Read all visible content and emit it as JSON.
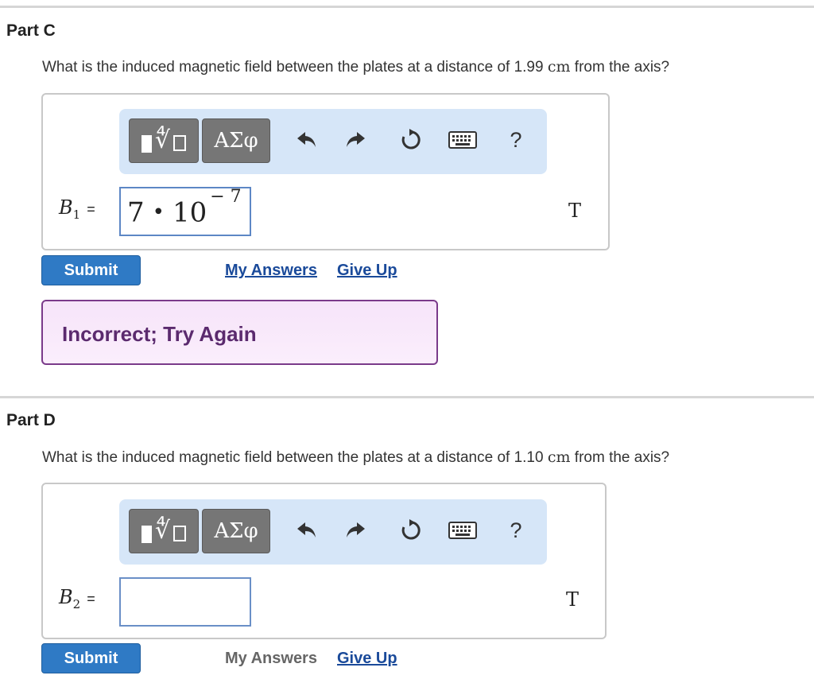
{
  "part_c": {
    "title": "Part C",
    "question_before": "What is the induced magnetic field between the plates at a distance of 1.99 ",
    "question_unit": "cm",
    "question_after": " from the axis?",
    "toolbar": {
      "greek_label": "ΑΣφ",
      "help_label": "?"
    },
    "variable": {
      "symbol": "B",
      "subscript": "1",
      "equals": "="
    },
    "answer": {
      "mantissa": "7",
      "operator": "•",
      "base": "10",
      "exponent": "− 7"
    },
    "unit": "T",
    "submit_label": "Submit",
    "my_answers_label": "My Answers",
    "give_up_label": "Give Up",
    "feedback": "Incorrect; Try Again"
  },
  "part_d": {
    "title": "Part D",
    "question_before": "What is the induced magnetic field between the plates at a distance of 1.10 ",
    "question_unit": "cm",
    "question_after": " from the axis?",
    "toolbar": {
      "greek_label": "ΑΣφ",
      "help_label": "?"
    },
    "variable": {
      "symbol": "B",
      "subscript": "2",
      "equals": "="
    },
    "answer": {
      "value": ""
    },
    "unit": "T",
    "submit_label": "Submit",
    "my_answers_label": "My Answers",
    "give_up_label": "Give Up"
  },
  "colors": {
    "submit_bg": "#2f7ac5",
    "toolbar_bg": "#d6e6f8",
    "feedback_border": "#7a3a8a",
    "feedback_text": "#5b2a6e",
    "link": "#1a4a9a"
  },
  "icons": [
    "template-icon",
    "greek-icon",
    "undo-icon",
    "redo-icon",
    "reset-icon",
    "keyboard-icon",
    "help-icon"
  ]
}
